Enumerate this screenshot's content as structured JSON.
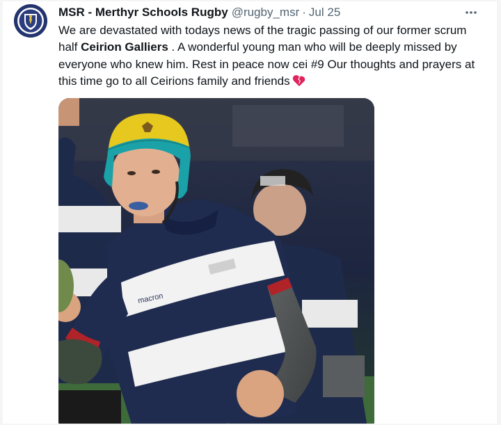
{
  "tweet": {
    "display_name": "MSR - Merthyr Schools Rugby",
    "handle": "@rugby_msr",
    "separator": "·",
    "date": "Jul 25",
    "more_label": "···",
    "text": {
      "line1_before": "We are devastated with todays news of the tragic passing of our former scrum half ",
      "name_bold": "Ceirion Galliers",
      "after_name": " . A wonderful young man who will be deeply missed by everyone who knew him. Rest in peace now cei #9 Our thoughts and prayers at this time go to all Ceirions family and friends"
    },
    "emoji_icon": "broken-heart-icon",
    "media": {
      "description_icon": "photo",
      "shirt_sponsor": "macron",
      "colors": {
        "shirt_navy": "#1f2b4f",
        "shirt_white": "#f2f2f2",
        "scrum_cap_teal": "#1aa2a8",
        "scrum_cap_yellow": "#e6c81e"
      }
    },
    "colors": {
      "text_primary": "#0f1419",
      "text_secondary": "#536471",
      "accent": "#1d9bf0",
      "emoji_red": "#e0245e"
    }
  }
}
